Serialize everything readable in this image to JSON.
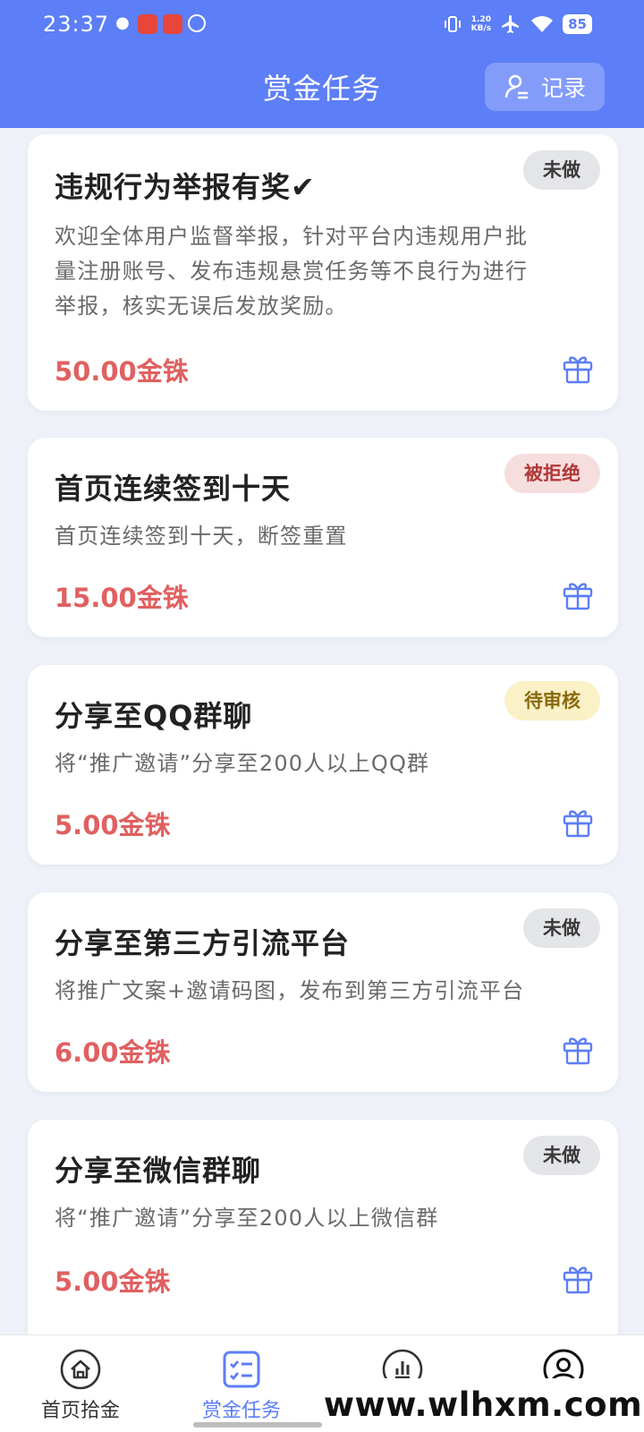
{
  "statusbar": {
    "time": "23:37",
    "apps": [
      "wechat-icon",
      "app-red-1",
      "app-red-2",
      "app-ring"
    ],
    "net_speed_value": "1.20",
    "net_speed_unit": "KB/s",
    "battery": "85"
  },
  "header": {
    "title": "赏金任务",
    "record_label": "记录"
  },
  "tasks": [
    {
      "title": "违规行为举报有奖✔",
      "status": "未做",
      "status_type": "todo",
      "desc_lines": [
        "欢迎全体用户监督举报，针对平台内违规用户批",
        "量注册账号、发布违规悬赏任务等不良行为进行",
        "举报，核实无误后发放奖励。"
      ],
      "reward": "50.00金铢"
    },
    {
      "title": "首页连续签到十天",
      "status": "被拒绝",
      "status_type": "rejected",
      "desc_lines": [
        "首页连续签到十天，断签重置"
      ],
      "reward": "15.00金铢"
    },
    {
      "title": "分享至QQ群聊",
      "status": "待审核",
      "status_type": "pending",
      "desc_lines": [
        "将“推广邀请”分享至200人以上QQ群"
      ],
      "reward": "5.00金铢"
    },
    {
      "title": "分享至第三方引流平台",
      "status": "未做",
      "status_type": "todo",
      "desc_lines": [
        "将推广文案+邀请码图，发布到第三方引流平台"
      ],
      "reward": "6.00金铢"
    },
    {
      "title": "分享至微信群聊",
      "status": "未做",
      "status_type": "todo",
      "desc_lines": [
        "将“推广邀请”分享至200人以上微信群"
      ],
      "reward": "5.00金铢"
    }
  ],
  "tabbar": {
    "items": [
      {
        "label": "首页拾金",
        "icon": "home-icon",
        "active": false
      },
      {
        "label": "赏金任务",
        "icon": "task-list-icon",
        "active": true
      },
      {
        "label": "",
        "icon": "chart-icon",
        "active": false
      },
      {
        "label": "",
        "icon": "profile-icon",
        "active": false
      }
    ]
  },
  "watermark": "www.wlhxm.com",
  "colors": {
    "primary": "#5c7ef7",
    "reward": "#e06060",
    "background": "#eef1f7"
  }
}
